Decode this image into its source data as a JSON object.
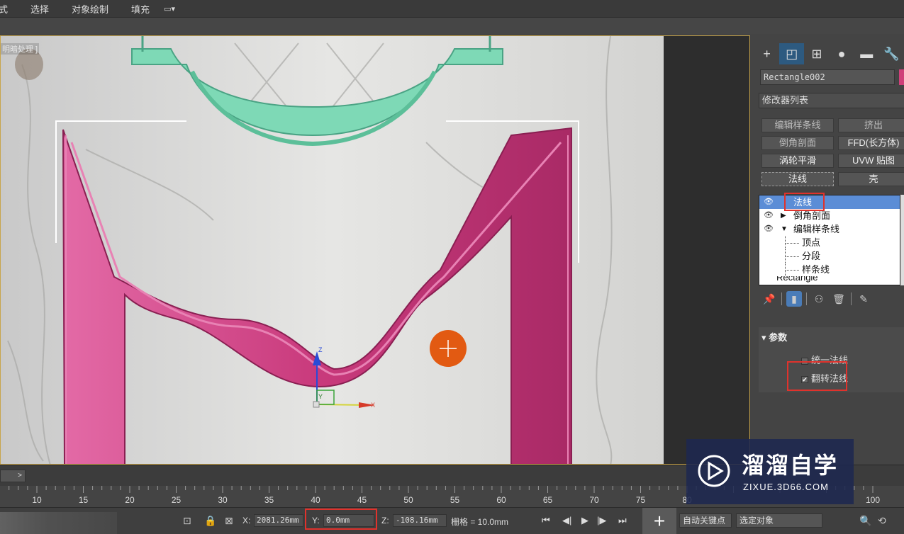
{
  "menu": {
    "items": [
      "式",
      "选择",
      "对象绘制",
      "填充"
    ]
  },
  "viewport": {
    "label": "明暗处理 ]",
    "axes": {
      "z": "Z",
      "y": "Y",
      "x": "X"
    }
  },
  "panel": {
    "tabs": [
      "create-icon",
      "modify-icon",
      "hierarchy-icon",
      "motion-icon",
      "display-icon",
      "utilities-icon"
    ],
    "object_name": "Rectangle002",
    "modifier_list": "修改器列表",
    "modifier_buttons": [
      "编辑样条线",
      "挤出",
      "倒角剖面",
      "FFD(长方体)",
      "涡轮平滑",
      "UVW 贴图",
      "法线",
      "壳"
    ],
    "stack": {
      "items": [
        {
          "label": "法线",
          "active": true
        },
        {
          "label": "倒角剖面",
          "active": false
        },
        {
          "label": "编辑样条线",
          "active": false
        }
      ],
      "subitems": [
        "顶点",
        "分段",
        "样条线"
      ],
      "cut": "Rectangle"
    },
    "params": {
      "header": "参数",
      "unify": "统一法线",
      "flip": "翻转法线",
      "flip_checked": true
    }
  },
  "timeline": {
    "thumb": ">",
    "ticks": [
      10,
      15,
      20,
      25,
      30,
      35,
      40,
      45,
      50,
      55,
      60,
      65,
      70,
      75,
      80,
      100
    ]
  },
  "status": {
    "x_label": "X:",
    "x_value": "2081.26mm",
    "y_label": "Y:",
    "y_value": "0.0mm",
    "z_label": "Z:",
    "z_value": "-108.16mm",
    "grid": "栅格 = 10.0mm",
    "autokey": "自动关键点",
    "selset": "选定对象"
  },
  "watermark": {
    "title": "溜溜自学",
    "sub": "ZIXUE.3D66.COM"
  },
  "colors": {
    "accent": "#2d5a80",
    "highlight": "#e0322c",
    "frame_pink": "#c93a7c",
    "frame_green": "#7ed9b6"
  }
}
